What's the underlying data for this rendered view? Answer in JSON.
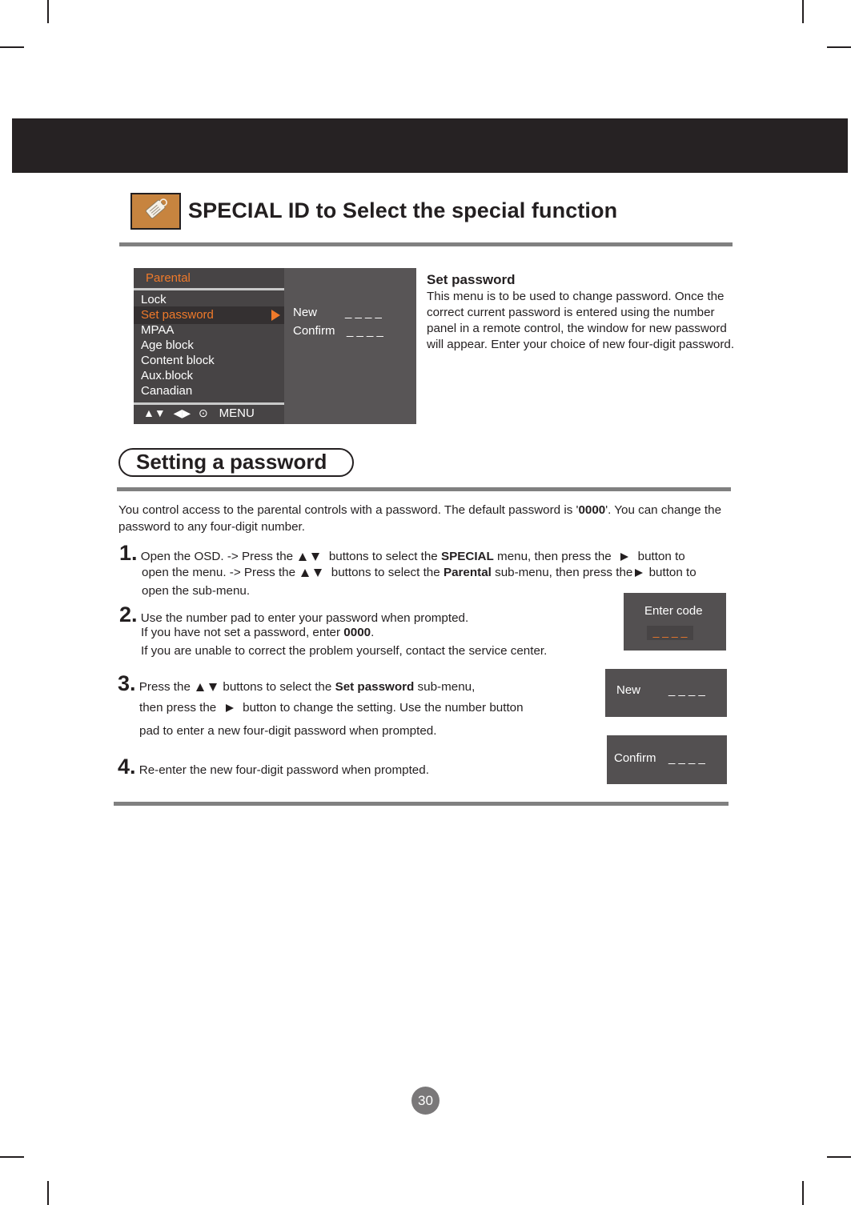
{
  "header": {
    "title": "SPECIAL ID to Select the special function",
    "icon": "tag-icon"
  },
  "osd_menu": {
    "title": "Parental",
    "items": [
      {
        "label": "Lock",
        "selected": false
      },
      {
        "label": "Set password",
        "selected": true
      },
      {
        "label": "MPAA",
        "selected": false
      },
      {
        "label": "Age block",
        "selected": false
      },
      {
        "label": "Content block",
        "selected": false
      },
      {
        "label": "Aux.block",
        "selected": false
      },
      {
        "label": "Canadian",
        "selected": false
      }
    ],
    "footer_icons": [
      "up-down-icon",
      "left-right-icon",
      "ok-icon"
    ],
    "footer_symbols": [
      "▲▼",
      "◀▶",
      "⊙"
    ],
    "footer_menu_label": "MENU",
    "submenu": {
      "new_label": "New",
      "new_value": "_ _ _ _",
      "confirm_label": "Confirm",
      "confirm_value": "_ _ _ _"
    }
  },
  "description": {
    "heading": "Set password",
    "body": "This menu is to be used to change password. Once the correct current password is entered using the number panel in a remote control, the window for new password will appear. Enter your choice of new four-digit password."
  },
  "section": {
    "title": "Setting a password",
    "intro_pre": "You control access to the parental controls with a password. The default password is '",
    "intro_bold": "0000",
    "intro_post": "'. You can change the password to any four-digit number."
  },
  "steps": {
    "s1": {
      "num": "1.",
      "l1a": "Open the OSD. -> Press the",
      "l1b": "buttons to select the",
      "l1c": "SPECIAL",
      "l1d": "menu, then press the",
      "l1e": "button to",
      "l2a": "open the menu. -> Press the",
      "l2b": "buttons to select the",
      "l2c": "Parental",
      "l2d": "sub-menu, then press the",
      "l2e": "button to",
      "l3": "open the sub-menu."
    },
    "s2": {
      "num": "2.",
      "l1": "Use the number pad to enter your password when prompted.",
      "l2a": "If you have not set a password, enter",
      "l2b": "0000",
      "l2c": ".",
      "l3": "If you are unable to correct the problem yourself, contact the service center."
    },
    "s3": {
      "num": "3.",
      "l1a": "Press the",
      "l1b": "buttons to select the",
      "l1c": "Set password",
      "l1d": "sub-menu,",
      "l2a": "then press the",
      "l2b": "button to change the setting. Use the number button",
      "l3": "pad to enter a new four-digit password when prompted."
    },
    "s4": {
      "num": "4.",
      "l1": "Re-enter the new four-digit password when prompted."
    }
  },
  "mini_windows": {
    "enter_code_label": "Enter code",
    "enter_code_value": "_ _ _ _",
    "new_label": "New",
    "new_value": "_ _ _ _",
    "confirm_label": "Confirm",
    "confirm_value": "_ _ _ _"
  },
  "colors": {
    "accent_orange": "#f07a2a",
    "osd_dark": "#474445",
    "osd_panel": "#585556",
    "rule_gray": "#808080",
    "icon_bg": "#c7843f"
  },
  "page_number": "30"
}
